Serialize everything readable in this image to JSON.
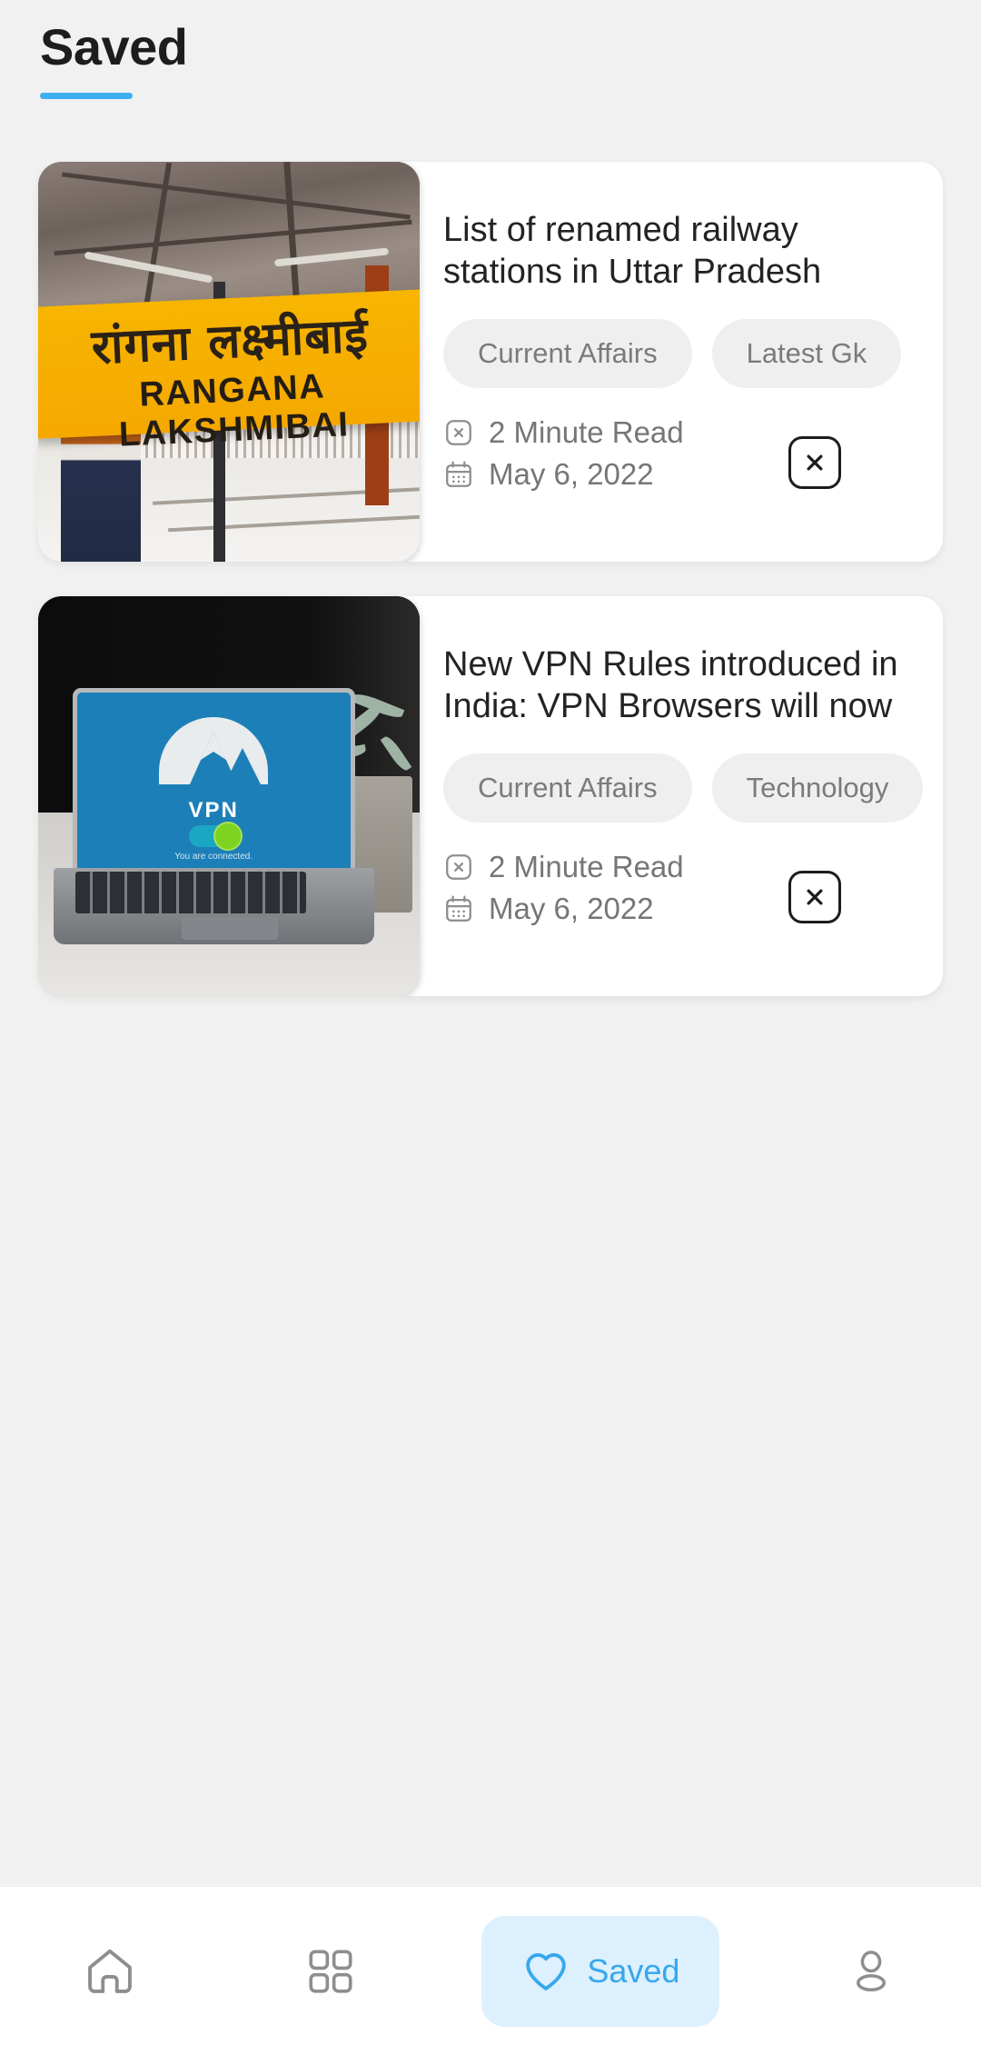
{
  "header": {
    "title": "Saved",
    "accent_color": "#3daff0"
  },
  "theme": {
    "background": "#f1f1f1",
    "card_background": "#ffffff",
    "chip_background": "#efefef",
    "chip_text": "#7b7b7b",
    "meta_text": "#767676",
    "accent": "#3daff0",
    "nav_active_pill": "#ddf0fd",
    "nav_inactive_icon": "#8e8e8e"
  },
  "cards": [
    {
      "title": "List of renamed railway\nstations in Uttar Pradesh",
      "thumbnail_alt": "Railway station yellow sign board reading RANGANA LAKSHMIBAI",
      "thumbnail_sign_hindi": "रांगना लक्ष्मीबाई",
      "thumbnail_sign_english": "RANGANA LAKSHMIBAI",
      "chips": [
        "Current Affairs",
        "Latest Gk"
      ],
      "read_time": "2 Minute Read",
      "date": "May 6, 2022",
      "read_icon": "clock-icon",
      "date_icon": "calendar-icon",
      "remove_icon": "close-icon"
    },
    {
      "title": "New VPN Rules introduced in\nIndia: VPN Browsers will now",
      "thumbnail_alt": "Laptop on desk showing a VPN application connected screen",
      "thumbnail_screen_label": "VPN",
      "thumbnail_screen_status": "You are connected.",
      "chips": [
        "Current Affairs",
        "Technology"
      ],
      "read_time": "2 Minute Read",
      "date": "May 6, 2022",
      "read_icon": "clock-icon",
      "date_icon": "calendar-icon",
      "remove_icon": "close-icon"
    }
  ],
  "bottom_nav": {
    "items": [
      {
        "label": "",
        "icon": "home-icon",
        "active": false
      },
      {
        "label": "",
        "icon": "grid-icon",
        "active": false
      },
      {
        "label": "Saved",
        "icon": "heart-icon",
        "active": true
      },
      {
        "label": "",
        "icon": "person-icon",
        "active": false
      }
    ]
  }
}
